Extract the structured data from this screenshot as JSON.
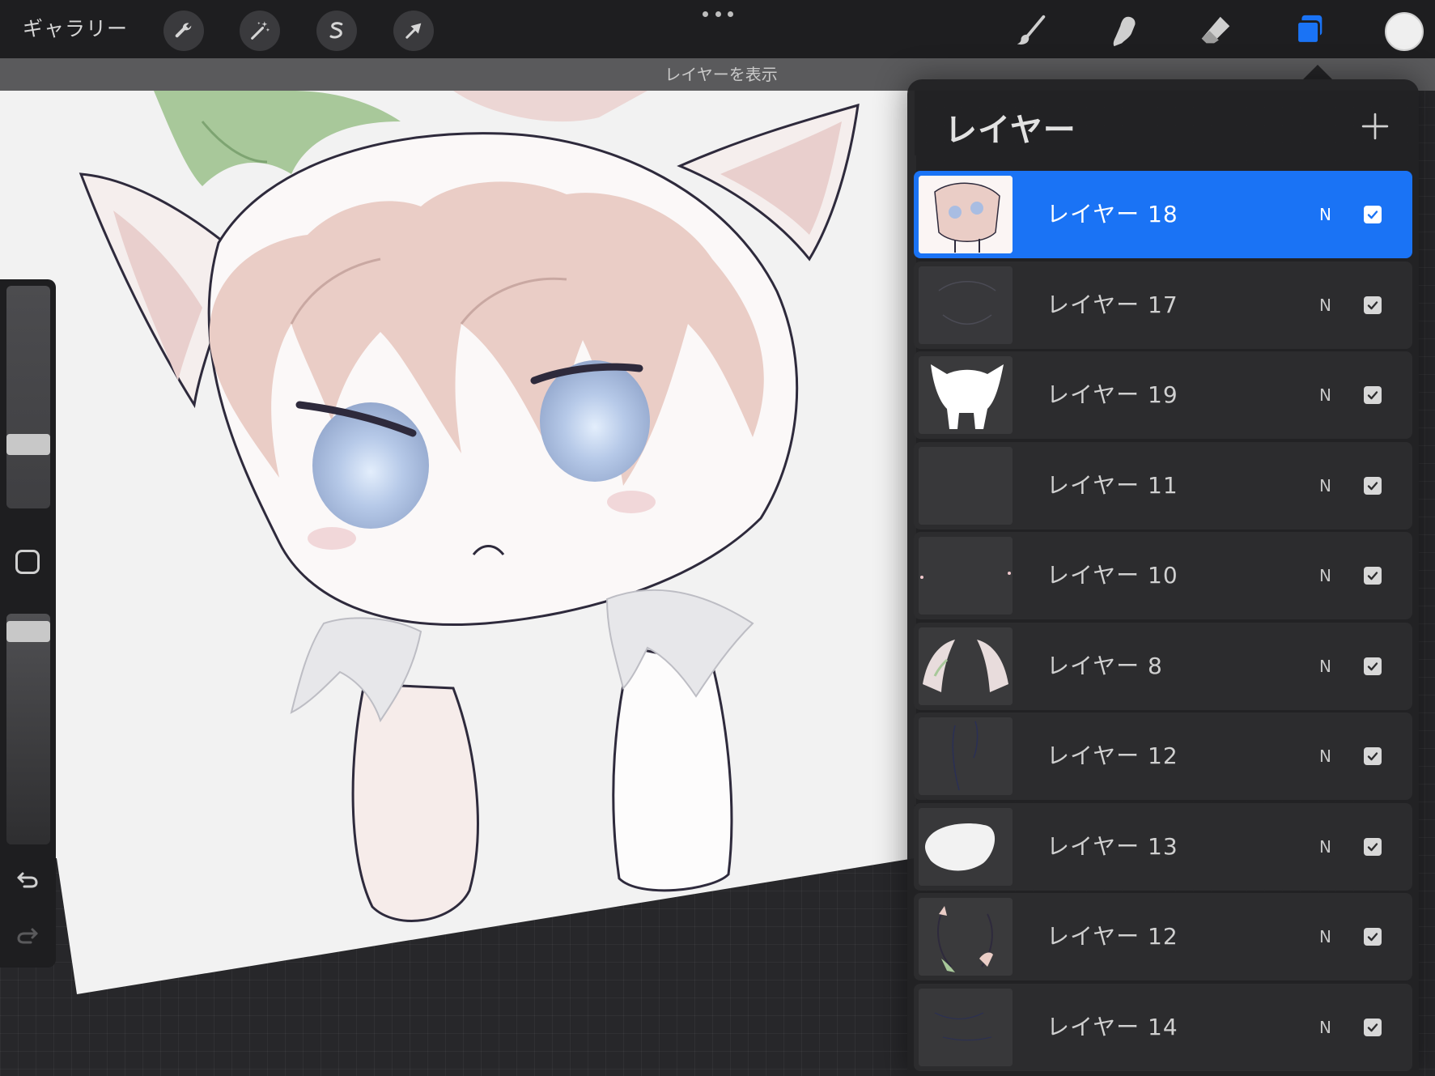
{
  "top_bar": {
    "gallery_label": "ギャラリー",
    "left_tools": [
      {
        "id": "actions",
        "icon": "wrench-icon"
      },
      {
        "id": "adjustments",
        "icon": "magic-wand-icon"
      },
      {
        "id": "selection",
        "icon": "selection-s-icon"
      },
      {
        "id": "transform",
        "icon": "arrow-cursor-icon"
      }
    ],
    "right_tools": [
      {
        "id": "brush",
        "icon": "brush-icon"
      },
      {
        "id": "smudge",
        "icon": "smudge-finger-icon"
      },
      {
        "id": "eraser",
        "icon": "eraser-icon"
      },
      {
        "id": "layers",
        "icon": "layers-icon",
        "active": true
      }
    ],
    "accent_color": "#1a73f5",
    "current_color": "#efefef"
  },
  "notice": {
    "text": "レイヤーを表示"
  },
  "layers_panel": {
    "title": "レイヤー",
    "add_icon": "plus-icon",
    "layers": [
      {
        "name": "レイヤー 18",
        "mode": "N",
        "visible": true,
        "active": true
      },
      {
        "name": "レイヤー 17",
        "mode": "N",
        "visible": true,
        "active": false
      },
      {
        "name": "レイヤー 19",
        "mode": "N",
        "visible": true,
        "active": false
      },
      {
        "name": "レイヤー 11",
        "mode": "N",
        "visible": true,
        "active": false
      },
      {
        "name": "レイヤー 10",
        "mode": "N",
        "visible": true,
        "active": false
      },
      {
        "name": "レイヤー 8",
        "mode": "N",
        "visible": true,
        "active": false
      },
      {
        "name": "レイヤー 12",
        "mode": "N",
        "visible": true,
        "active": false
      },
      {
        "name": "レイヤー 13",
        "mode": "N",
        "visible": true,
        "active": false
      },
      {
        "name": "レイヤー 12",
        "mode": "N",
        "visible": true,
        "active": false
      },
      {
        "name": "レイヤー 14",
        "mode": "N",
        "visible": true,
        "active": false
      }
    ]
  },
  "sidebar": {
    "undo_icon": "undo-icon",
    "redo_icon": "redo-icon",
    "modify_icon": "square-icon"
  }
}
